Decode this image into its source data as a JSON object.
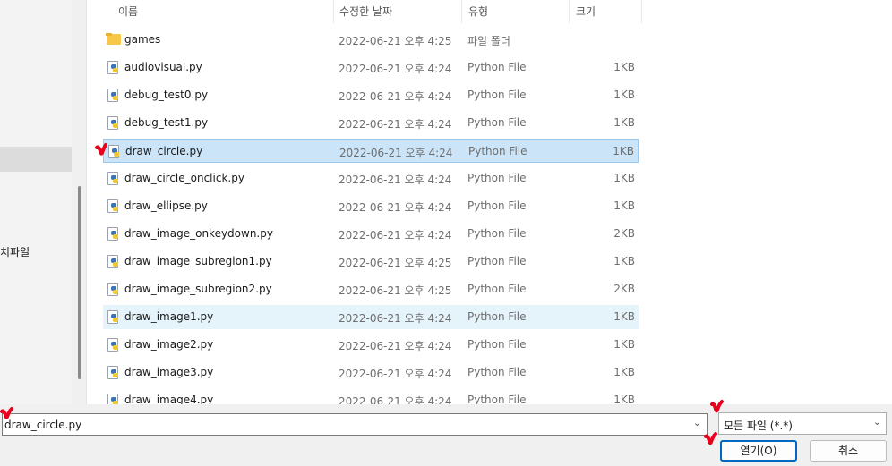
{
  "sidebar": {
    "partial_label": "치파일"
  },
  "columns": {
    "name": "이름",
    "date_modified": "수정한 날짜",
    "type": "유형",
    "size": "크기"
  },
  "files": [
    {
      "name": "games",
      "date": "2022-06-21 오후 4:25",
      "type": "파일 폴더",
      "size": "",
      "icon": "folder-icon"
    },
    {
      "name": "audiovisual.py",
      "date": "2022-06-21 오후 4:24",
      "type": "Python File",
      "size": "1KB",
      "icon": "python-file-icon"
    },
    {
      "name": "debug_test0.py",
      "date": "2022-06-21 오후 4:24",
      "type": "Python File",
      "size": "1KB",
      "icon": "python-file-icon"
    },
    {
      "name": "debug_test1.py",
      "date": "2022-06-21 오후 4:24",
      "type": "Python File",
      "size": "1KB",
      "icon": "python-file-icon"
    },
    {
      "name": "draw_circle.py",
      "date": "2022-06-21 오후 4:24",
      "type": "Python File",
      "size": "1KB",
      "icon": "python-file-icon"
    },
    {
      "name": "draw_circle_onclick.py",
      "date": "2022-06-21 오후 4:24",
      "type": "Python File",
      "size": "1KB",
      "icon": "python-file-icon"
    },
    {
      "name": "draw_ellipse.py",
      "date": "2022-06-21 오후 4:24",
      "type": "Python File",
      "size": "1KB",
      "icon": "python-file-icon"
    },
    {
      "name": "draw_image_onkeydown.py",
      "date": "2022-06-21 오후 4:24",
      "type": "Python File",
      "size": "2KB",
      "icon": "python-file-icon"
    },
    {
      "name": "draw_image_subregion1.py",
      "date": "2022-06-21 오후 4:25",
      "type": "Python File",
      "size": "1KB",
      "icon": "python-file-icon"
    },
    {
      "name": "draw_image_subregion2.py",
      "date": "2022-06-21 오후 4:25",
      "type": "Python File",
      "size": "2KB",
      "icon": "python-file-icon"
    },
    {
      "name": "draw_image1.py",
      "date": "2022-06-21 오후 4:24",
      "type": "Python File",
      "size": "1KB",
      "icon": "python-file-icon"
    },
    {
      "name": "draw_image2.py",
      "date": "2022-06-21 오후 4:24",
      "type": "Python File",
      "size": "1KB",
      "icon": "python-file-icon"
    },
    {
      "name": "draw_image3.py",
      "date": "2022-06-21 오후 4:24",
      "type": "Python File",
      "size": "1KB",
      "icon": "python-file-icon"
    },
    {
      "name": "draw_image4.py",
      "date": "2022-06-21 오후 4:24",
      "type": "Python File",
      "size": "1KB",
      "icon": "python-file-icon"
    }
  ],
  "selected_file": "draw_circle.py",
  "hover_file": "draw_image1.py",
  "footer": {
    "filename_value": "draw_circle.py",
    "filter_value": "모든 파일 (*.*)",
    "open_label": "열기(O)",
    "cancel_label": "취소"
  },
  "colors": {
    "selection": "#cce4f7",
    "hover": "#e5f3fb",
    "primary_border": "#0067c0",
    "annotation": "#e8001c"
  }
}
